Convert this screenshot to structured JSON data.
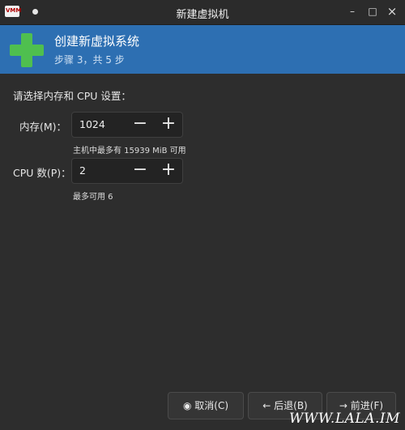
{
  "window": {
    "title": "新建虚拟机",
    "app_icon_text": "VMM",
    "minimize_glyph": "–",
    "maximize_glyph": "□",
    "close_glyph": "×"
  },
  "banner": {
    "title": "创建新虚拟系统",
    "step": "步骤 3，共 5 步"
  },
  "form": {
    "prompt": "请选择内存和 CPU 设置：",
    "memory": {
      "label": "内存(M)：",
      "value": "1024",
      "hint": "主机中最多有 15939 MiB 可用"
    },
    "cpu": {
      "label": "CPU 数(P)：",
      "value": "2",
      "hint": "最多可用 6"
    },
    "minus_glyph": "−",
    "plus_glyph": "+"
  },
  "buttons": {
    "cancel": "取消(C)",
    "cancel_icon": "◉",
    "back": "后退(B)",
    "back_icon": "←",
    "forward": "前进(F)",
    "forward_icon": "→"
  },
  "watermark": "WWW.LALA.IM",
  "colors": {
    "banner": "#2d6fb2",
    "plus_icon": "#4fbf4f",
    "background": "#2d2d2d"
  }
}
